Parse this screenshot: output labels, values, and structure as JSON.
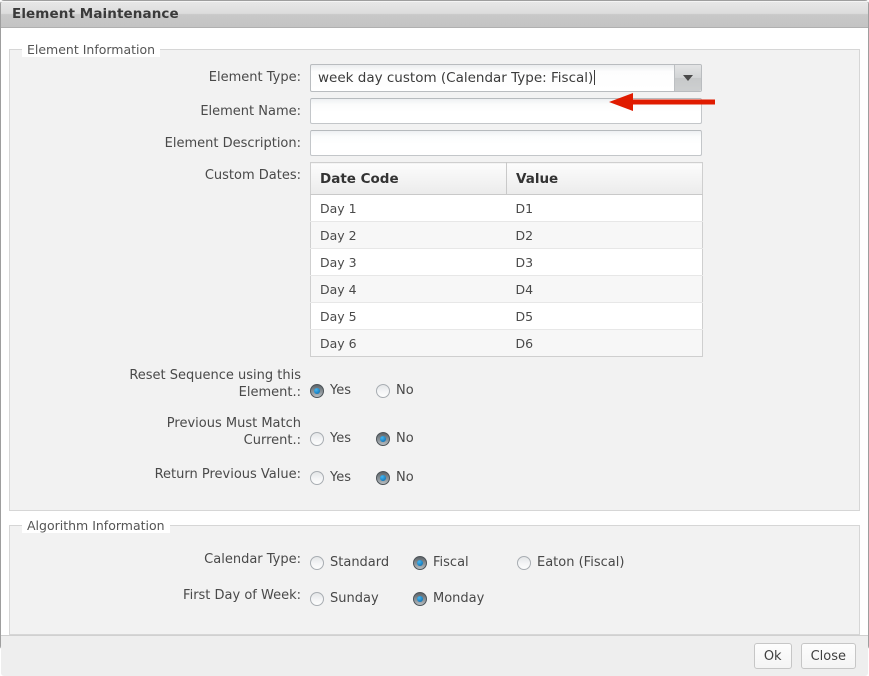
{
  "window": {
    "title": "Element Maintenance"
  },
  "element_information": {
    "legend": "Element Information",
    "element_type": {
      "label": "Element Type:",
      "value": "week day custom (Calendar Type: Fiscal)",
      "dropdown_icon": "chevron-down-icon"
    },
    "element_name": {
      "label": "Element Name:",
      "value": "",
      "placeholder": ""
    },
    "element_description": {
      "label": "Element Description:",
      "value": "",
      "placeholder": ""
    },
    "custom_dates": {
      "label": "Custom Dates:",
      "columns": [
        "Date Code",
        "Value"
      ],
      "rows": [
        [
          "Day 1",
          "D1"
        ],
        [
          "Day 2",
          "D2"
        ],
        [
          "Day 3",
          "D3"
        ],
        [
          "Day 4",
          "D4"
        ],
        [
          "Day 5",
          "D5"
        ],
        [
          "Day 6",
          "D6"
        ]
      ]
    },
    "reset_sequence": {
      "label": "Reset Sequence using this Element.:",
      "label_line1": "Reset Sequence using this",
      "label_line2": "Element.:",
      "options": [
        "Yes",
        "No"
      ],
      "selected": "Yes"
    },
    "previous_must_match": {
      "label": "Previous Must Match Current.:",
      "label_line1": "Previous Must Match",
      "label_line2": "Current.:",
      "options": [
        "Yes",
        "No"
      ],
      "selected": "No"
    },
    "return_previous_value": {
      "label": "Return Previous Value:",
      "options": [
        "Yes",
        "No"
      ],
      "selected": "No"
    }
  },
  "algorithm_information": {
    "legend": "Algorithm Information",
    "calendar_type": {
      "label": "Calendar Type:",
      "options": [
        "Standard",
        "Fiscal",
        "Eaton (Fiscal)"
      ],
      "selected": "Fiscal"
    },
    "first_day_of_week": {
      "label": "First Day of Week:",
      "options": [
        "Sunday",
        "Monday"
      ],
      "selected": "Monday"
    }
  },
  "footer": {
    "ok_label": "Ok",
    "close_label": "Close"
  },
  "annotation": {
    "arrow_color": "#e01b00",
    "arrow_points_to": "element-type-dropdown-button"
  }
}
